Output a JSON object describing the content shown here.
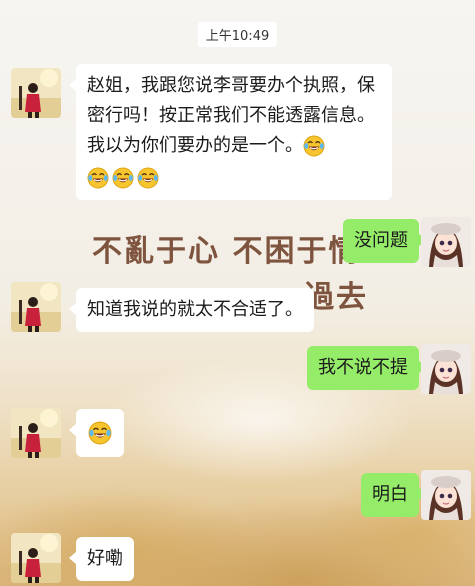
{
  "timestamp": "上午10:49",
  "wallpaper": {
    "line1": "不亂于心 不困于情",
    "line2": "過去"
  },
  "messages": [
    {
      "side": "left",
      "text": "赵姐，我跟您说李哥要办个执照，保密行吗！按正常我们不能透露信息。我以为你们要办的是一个。",
      "emoji": [
        "laugh-cry",
        "laugh-cry",
        "laugh-cry",
        "laugh-cry"
      ]
    },
    {
      "side": "right",
      "text": "没问题"
    },
    {
      "side": "left",
      "text": "知道我说的就太不合适了。"
    },
    {
      "side": "right",
      "text": "我不说不提"
    },
    {
      "side": "left",
      "text": "",
      "emoji": [
        "laugh-cry"
      ]
    },
    {
      "side": "right",
      "text": "明白"
    },
    {
      "side": "left",
      "text": "好嘞"
    }
  ],
  "colors": {
    "outgoing_bubble": "#95ec69",
    "incoming_bubble": "#ffffff"
  }
}
